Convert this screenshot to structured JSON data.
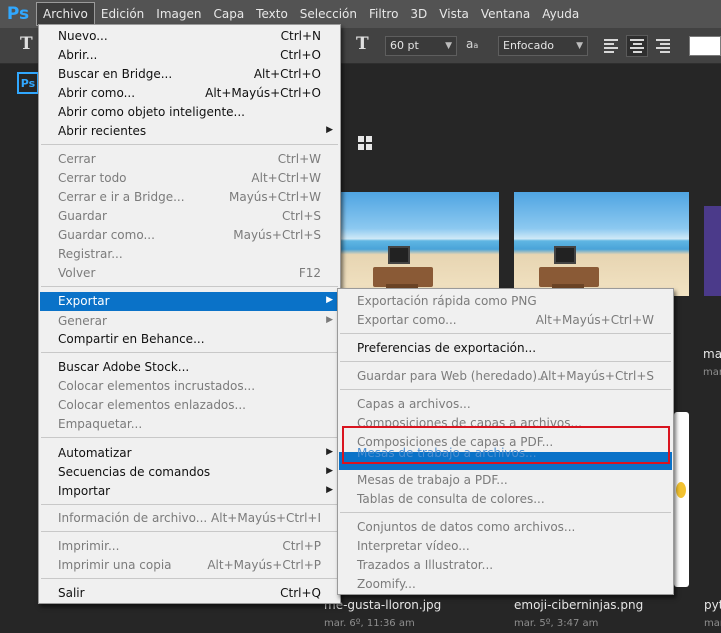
{
  "app": {
    "logo": "Ps",
    "home_logo": "Ps"
  },
  "menubar": {
    "items": [
      "Archivo",
      "Edición",
      "Imagen",
      "Capa",
      "Texto",
      "Selección",
      "Filtro",
      "3D",
      "Vista",
      "Ventana",
      "Ayuda"
    ],
    "active": "Archivo"
  },
  "options": {
    "font_size": "60 pt",
    "antialias": "Enfocado",
    "tool_glyph": "T",
    "orientation_glyph": "T",
    "aa_glyph": "a",
    "text_color": "#ffffff"
  },
  "archivo_menu": {
    "items": [
      {
        "label": "Nuevo...",
        "shortcut": "Ctrl+N"
      },
      {
        "label": "Abrir...",
        "shortcut": "Ctrl+O"
      },
      {
        "label": "Buscar en Bridge...",
        "shortcut": "Alt+Ctrl+O"
      },
      {
        "label": "Abrir como...",
        "shortcut": "Alt+Mayús+Ctrl+O"
      },
      {
        "label": "Abrir como objeto inteligente...",
        "shortcut": ""
      },
      {
        "label": "Abrir recientes",
        "shortcut": "",
        "submenu": true
      },
      {
        "label": "Cerrar",
        "shortcut": "Ctrl+W",
        "disabled": true
      },
      {
        "label": "Cerrar todo",
        "shortcut": "Alt+Ctrl+W",
        "disabled": true
      },
      {
        "label": "Cerrar e ir a Bridge...",
        "shortcut": "Mayús+Ctrl+W",
        "disabled": true
      },
      {
        "label": "Guardar",
        "shortcut": "Ctrl+S",
        "disabled": true
      },
      {
        "label": "Guardar como...",
        "shortcut": "Mayús+Ctrl+S",
        "disabled": true
      },
      {
        "label": "Registrar...",
        "shortcut": "",
        "disabled": true
      },
      {
        "label": "Volver",
        "shortcut": "F12",
        "disabled": true
      },
      {
        "label": "Exportar",
        "shortcut": "",
        "submenu": true,
        "highlighted": true
      },
      {
        "label": "Generar",
        "shortcut": "",
        "submenu": true,
        "disabled": true
      },
      {
        "label": "Compartir en Behance...",
        "shortcut": ""
      },
      {
        "label": "Buscar Adobe Stock...",
        "shortcut": ""
      },
      {
        "label": "Colocar elementos incrustados...",
        "shortcut": "",
        "disabled": true
      },
      {
        "label": "Colocar elementos enlazados...",
        "shortcut": "",
        "disabled": true
      },
      {
        "label": "Empaquetar...",
        "shortcut": "",
        "disabled": true
      },
      {
        "label": "Automatizar",
        "shortcut": "",
        "submenu": true
      },
      {
        "label": "Secuencias de comandos",
        "shortcut": "",
        "submenu": true
      },
      {
        "label": "Importar",
        "shortcut": "",
        "submenu": true
      },
      {
        "label": "Información de archivo...",
        "shortcut": "Alt+Mayús+Ctrl+I",
        "disabled": true
      },
      {
        "label": "Imprimir...",
        "shortcut": "Ctrl+P",
        "disabled": true
      },
      {
        "label": "Imprimir una copia",
        "shortcut": "Alt+Mayús+Ctrl+P",
        "disabled": true
      },
      {
        "label": "Salir",
        "shortcut": "Ctrl+Q"
      }
    ]
  },
  "exportar_submenu": {
    "items": [
      {
        "label": "Exportación rápida como PNG",
        "shortcut": "",
        "disabled": true
      },
      {
        "label": "Exportar como...",
        "shortcut": "Alt+Mayús+Ctrl+W",
        "disabled": true
      },
      {
        "label": "Preferencias de exportación...",
        "shortcut": ""
      },
      {
        "label": "Guardar para Web (heredado)...",
        "shortcut": "Alt+Mayús+Ctrl+S",
        "disabled": true
      },
      {
        "label": "Capas a archivos...",
        "shortcut": "",
        "disabled": true
      },
      {
        "label": "Composiciones de capas a archivos...",
        "shortcut": "",
        "disabled": true
      },
      {
        "label": "Composiciones de capas a PDF...",
        "shortcut": "",
        "disabled": true
      },
      {
        "label": "Mesas de trabajo a archivos...",
        "shortcut": "",
        "disabled": true,
        "highlighted": true
      },
      {
        "label": "Mesas de trabajo a PDF...",
        "shortcut": "",
        "disabled": true
      },
      {
        "label": "Tablas de consulta de colores...",
        "shortcut": "",
        "disabled": true
      },
      {
        "label": "Conjuntos de datos como archivos...",
        "shortcut": "",
        "disabled": true
      },
      {
        "label": "Interpretar vídeo...",
        "shortcut": "",
        "disabled": true
      },
      {
        "label": "Trazados a Illustrator...",
        "shortcut": "",
        "disabled": true
      },
      {
        "label": "Zoomify...",
        "shortcut": "",
        "disabled": true
      }
    ]
  },
  "recent_files": [
    {
      "name": "me-gusta-lloron.jpg",
      "date": "mar. 6º, 11:36 am"
    },
    {
      "name": "emoji-ciberninjas.png",
      "date": "mar. 5º, 3:47 am"
    },
    {
      "name": "pyt",
      "date": "mar."
    },
    {
      "name": "ma",
      "date": "mar."
    }
  ]
}
